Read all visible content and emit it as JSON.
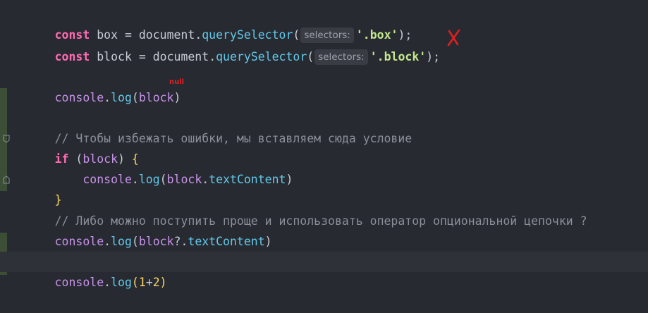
{
  "editor": {
    "lines": {
      "l1": {
        "kw": "const",
        "name": " box ",
        "eq": "= ",
        "obj": "document",
        "dot": ".",
        "method": "querySelector",
        "open": "(",
        "hint": "selectors:",
        "arg": "'.box'",
        "close": ")",
        "semi": ";"
      },
      "l2": {
        "kw": "const",
        "name": " block ",
        "eq": "= ",
        "obj": "document",
        "dot": ".",
        "method": "querySelector",
        "open": "(",
        "hint": "selectors:",
        "arg": "'.block'",
        "close": ")",
        "semi": ";"
      },
      "l4": {
        "obj": "console",
        "dot": ".",
        "method": "log",
        "open": "(",
        "arg": "block",
        "close": ")"
      },
      "l6": {
        "comment": "// Чтобы избежать ошибки, мы вставляем сюда условие"
      },
      "l7": {
        "kw": "if",
        "space": " ",
        "open": "(",
        "arg": "block",
        "close": ")",
        "brace": " {"
      },
      "l8": {
        "indent": "    ",
        "obj": "console",
        "dot": ".",
        "method": "log",
        "open": "(",
        "arg": "block",
        "dot2": ".",
        "prop": "textContent",
        "close": ")"
      },
      "l9": {
        "brace": "}"
      },
      "l10": {
        "comment": "// Либо можно поступить проще и использовать оператор опциональной цепочки ?"
      },
      "l11": {
        "obj": "console",
        "dot": ".",
        "method": "log",
        "open": "(",
        "arg": "block",
        "chain": "?.",
        "prop": "textContent",
        "close": ")"
      },
      "l13": {
        "obj": "console",
        "dot": ".",
        "method": "log",
        "open": "(",
        "n1": "1",
        "plus": "+",
        "n2": "2",
        "close": ")"
      }
    },
    "annotations": {
      "null_note": "null",
      "error_mark": "cross-mark"
    },
    "colors": {
      "background": "#282A31",
      "keyword": "#FF6BB3",
      "function": "#61C8E8",
      "string": "#C3E88D",
      "identifier": "#C792EA",
      "comment": "#8B8F99",
      "annotation": "#E02020"
    }
  }
}
